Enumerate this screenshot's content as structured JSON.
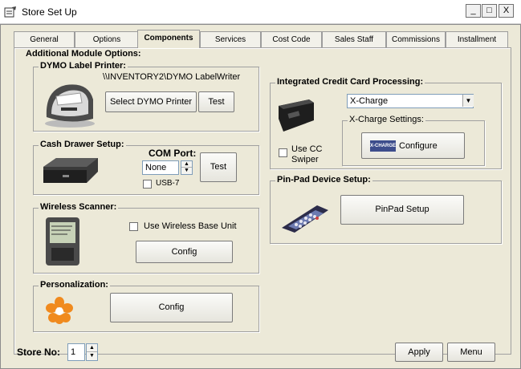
{
  "window": {
    "title": "Store Set Up",
    "controls": {
      "minimize": "_",
      "maximize": "□",
      "close": "X"
    }
  },
  "tabs": [
    {
      "label": "General",
      "active": false
    },
    {
      "label": "Options",
      "active": false
    },
    {
      "label": "Components",
      "active": true
    },
    {
      "label": "Services",
      "active": false
    },
    {
      "label": "Cost Code",
      "active": false
    },
    {
      "label": "Sales Staff",
      "active": false
    },
    {
      "label": "Commissions",
      "active": false
    },
    {
      "label": "Installment",
      "active": false
    }
  ],
  "section_title": "Additional Module Options:",
  "dymo": {
    "title": "DYMO Label Printer:",
    "path": "\\\\INVENTORY2\\DYMO LabelWriter",
    "select_label": "Select DYMO Printer",
    "test_label": "Test"
  },
  "cash_drawer": {
    "title": "Cash Drawer Setup:",
    "com_port_label": "COM Port:",
    "com_port_value": "None",
    "usb_label": "USB-7",
    "test_label": "Test"
  },
  "wireless": {
    "title": "Wireless Scanner:",
    "use_base_label": "Use Wireless Base Unit",
    "config_label": "Config"
  },
  "personalization": {
    "title": "Personalization:",
    "config_label": "Config"
  },
  "credit_card": {
    "title": "Integrated Credit Card Processing:",
    "processor_value": "X-Charge",
    "use_swiper_label": "Use CC\nSwiper",
    "settings_title": "X-Charge Settings:",
    "configure_label": "Configure",
    "logo_text": "X-CHARGE"
  },
  "pinpad": {
    "title": "Pin-Pad Device Setup:",
    "setup_label": "PinPad Setup"
  },
  "footer": {
    "store_no_label": "Store No:",
    "store_no_value": "1",
    "apply_label": "Apply",
    "menu_label": "Menu"
  }
}
